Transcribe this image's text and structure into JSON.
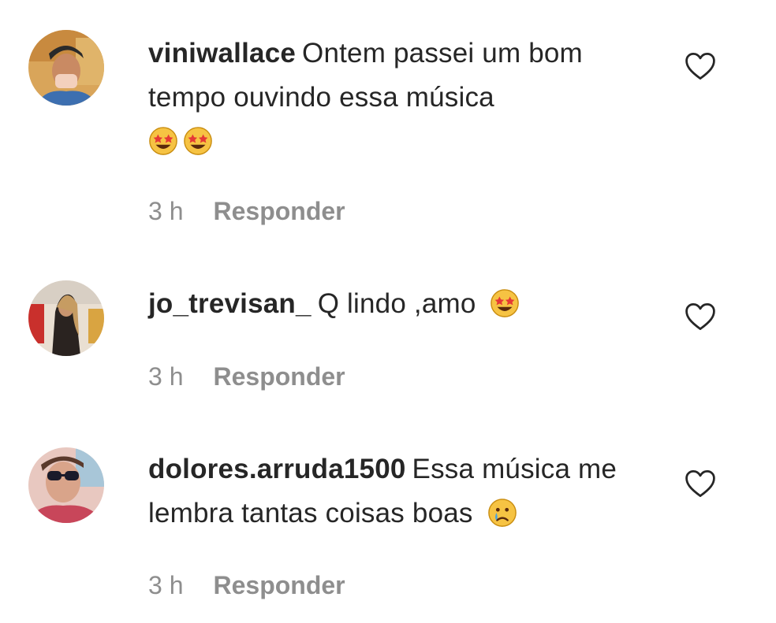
{
  "comments": [
    {
      "username": "viniwallace",
      "text": "Ontem passei um bom tempo ouvindo essa música",
      "emojis": [
        "star-struck",
        "star-struck"
      ],
      "time": "3 h",
      "reply_label": "Responder",
      "avatar_icon": "avatar-photo-man"
    },
    {
      "username": "jo_trevisan_",
      "text": "Q lindo ,amo",
      "emojis": [
        "star-struck"
      ],
      "time": "3 h",
      "reply_label": "Responder",
      "avatar_icon": "avatar-photo-woman"
    },
    {
      "username": "dolores.arruda1500",
      "text": "Essa música me lembra tantas coisas boas",
      "emojis": [
        "crying-face"
      ],
      "time": "3 h",
      "reply_label": "Responder",
      "avatar_icon": "avatar-photo-woman-sunglasses"
    }
  ],
  "icons": {
    "like": "heart-outline-icon"
  },
  "colors": {
    "text": "#262626",
    "meta": "#8e8e8e",
    "background": "#ffffff"
  }
}
